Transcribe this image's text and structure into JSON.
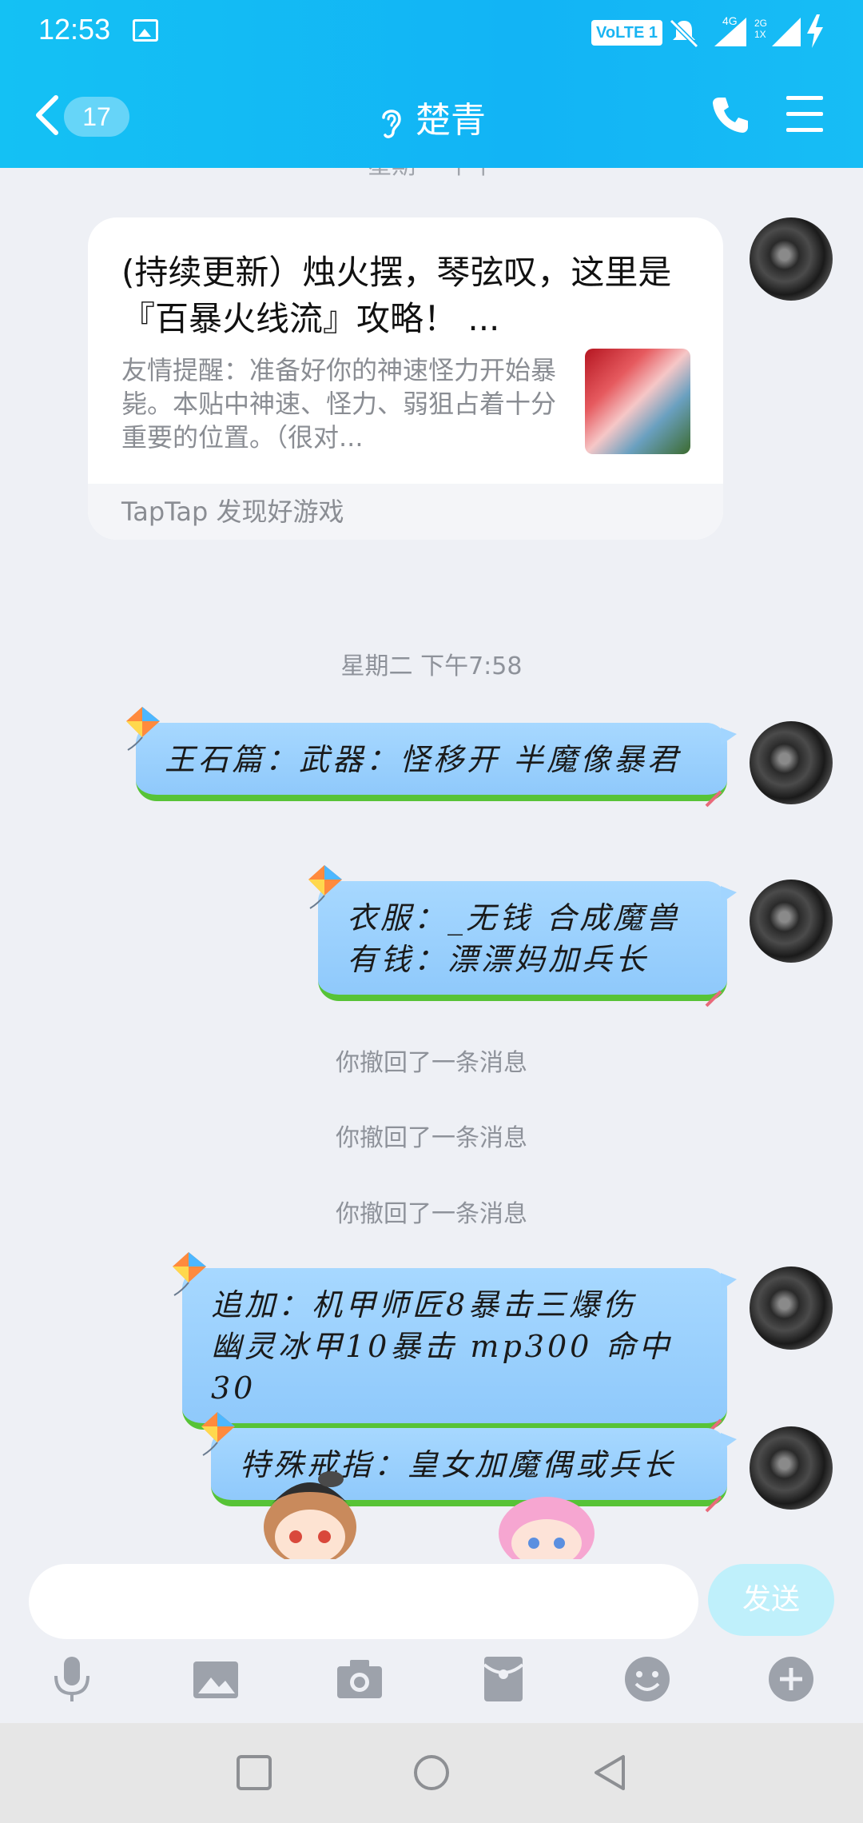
{
  "status_bar": {
    "time": "12:53",
    "volte": "VoLTE 1",
    "network": "4G",
    "network2": "2G 1X"
  },
  "header": {
    "unread_count": "17",
    "contact_name": "楚青"
  },
  "chat": {
    "clipped_time": "星期一 下午",
    "shared_card": {
      "title": "(持续更新）烛火摆，琴弦叹，这里是『百暴火线流』攻略！ ...",
      "description": "友情提醒：准备好你的神速怪力开始暴毙。本贴中神速、怪力、弱狙占着十分重要的位置。（很对...",
      "source": "TapTap 发现好游戏"
    },
    "timestamp": "星期二 下午7:58",
    "messages": [
      {
        "text": "王石篇：武器：怪移开 半魔像暴君"
      },
      {
        "text": "衣服：_无钱 合成魔兽\n有钱：漂漂妈加兵长"
      },
      {
        "text": "追加：机甲师匠8暴击三爆伤\n幽灵冰甲10暴击 mp300 命中30"
      },
      {
        "text": "特殊戒指：皇女加魔偶或兵长"
      }
    ],
    "recall_notices": [
      "你撤回了一条消息",
      "你撤回了一条消息",
      "你撤回了一条消息"
    ]
  },
  "input": {
    "placeholder": "",
    "send_label": "发送"
  },
  "toolbar_icons": [
    "microphone-icon",
    "image-icon",
    "camera-icon",
    "red-packet-icon",
    "emoji-icon",
    "plus-icon"
  ],
  "colors": {
    "header": "#14bdf4",
    "bubble": "#9fd3fd",
    "bubble_border": "#57c337",
    "background": "#eef0f5"
  }
}
